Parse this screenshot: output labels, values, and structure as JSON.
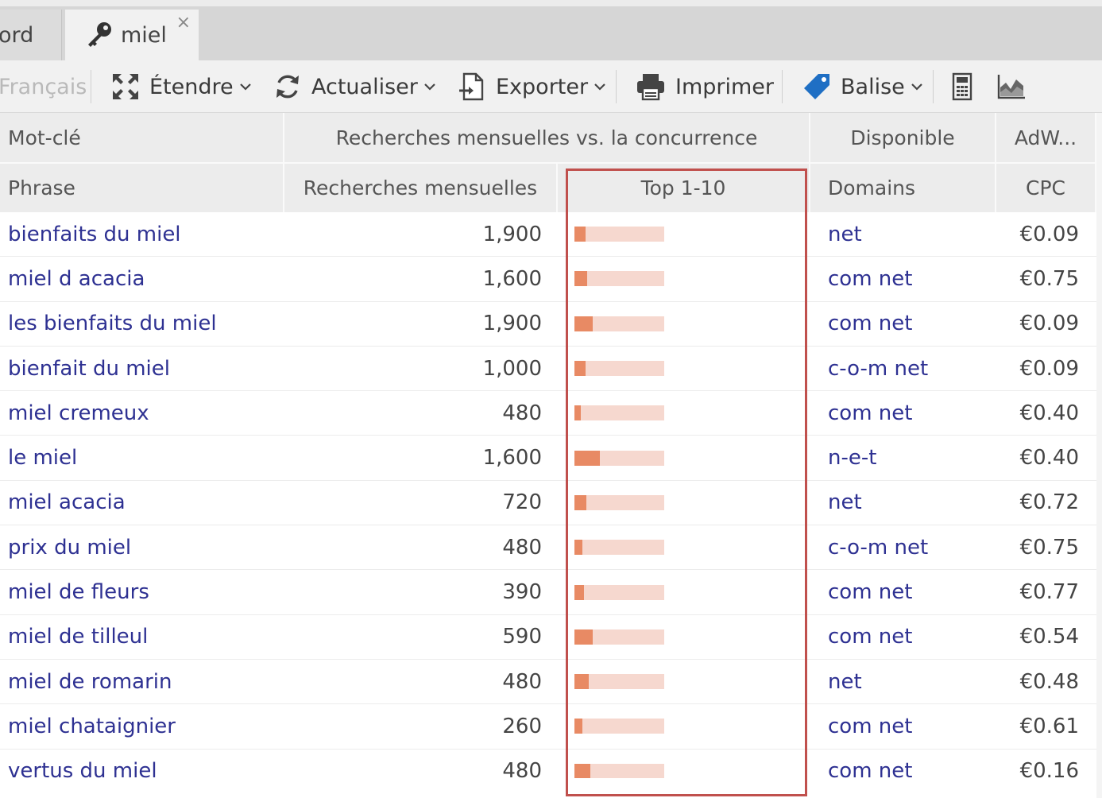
{
  "tabs": {
    "previous_label": "ord",
    "active_label": "miel",
    "close_glyph": "×"
  },
  "toolbar": {
    "language": "Français",
    "expand": "Étendre",
    "refresh": "Actualiser",
    "export": "Exporter",
    "print": "Imprimer",
    "tag": "Balise"
  },
  "header": {
    "group_keyword": "Mot-clé",
    "group_competition": "Recherches mensuelles vs. la concurrence",
    "group_available": "Disponible",
    "group_adwords": "AdW...",
    "col_phrase": "Phrase",
    "col_searches": "Recherches mensuelles",
    "col_top": "Top 1-10",
    "col_domains": "Domains",
    "col_cpc": "CPC"
  },
  "colors": {
    "link": "#2e3192",
    "bar_fill": "#e88a64",
    "bar_track": "#f6d8cf",
    "highlight": "#c0504d"
  },
  "rows": [
    {
      "phrase": "bienfaits du miel",
      "searches": "1,900",
      "top": 0.12,
      "domains": "net",
      "cpc": "€0.09"
    },
    {
      "phrase": "miel d acacia",
      "searches": "1,600",
      "top": 0.14,
      "domains": "com net",
      "cpc": "€0.75"
    },
    {
      "phrase": "les bienfaits du miel",
      "searches": "1,900",
      "top": 0.2,
      "domains": "com net",
      "cpc": "€0.09"
    },
    {
      "phrase": "bienfait du miel",
      "searches": "1,000",
      "top": 0.12,
      "domains": "c-o-m net",
      "cpc": "€0.09"
    },
    {
      "phrase": "miel cremeux",
      "searches": "480",
      "top": 0.07,
      "domains": "com net",
      "cpc": "€0.40"
    },
    {
      "phrase": "le miel",
      "searches": "1,600",
      "top": 0.28,
      "domains": "n-e-t",
      "cpc": "€0.40"
    },
    {
      "phrase": "miel acacia",
      "searches": "720",
      "top": 0.13,
      "domains": "net",
      "cpc": "€0.72"
    },
    {
      "phrase": "prix du miel",
      "searches": "480",
      "top": 0.09,
      "domains": "c-o-m net",
      "cpc": "€0.75"
    },
    {
      "phrase": "miel de fleurs",
      "searches": "390",
      "top": 0.11,
      "domains": "com net",
      "cpc": "€0.77"
    },
    {
      "phrase": "miel de tilleul",
      "searches": "590",
      "top": 0.2,
      "domains": "com net",
      "cpc": "€0.54"
    },
    {
      "phrase": "miel de romarin",
      "searches": "480",
      "top": 0.16,
      "domains": "net",
      "cpc": "€0.48"
    },
    {
      "phrase": "miel chataignier",
      "searches": "260",
      "top": 0.09,
      "domains": "com net",
      "cpc": "€0.61"
    },
    {
      "phrase": "vertus du miel",
      "searches": "480",
      "top": 0.18,
      "domains": "com net",
      "cpc": "€0.16"
    }
  ]
}
